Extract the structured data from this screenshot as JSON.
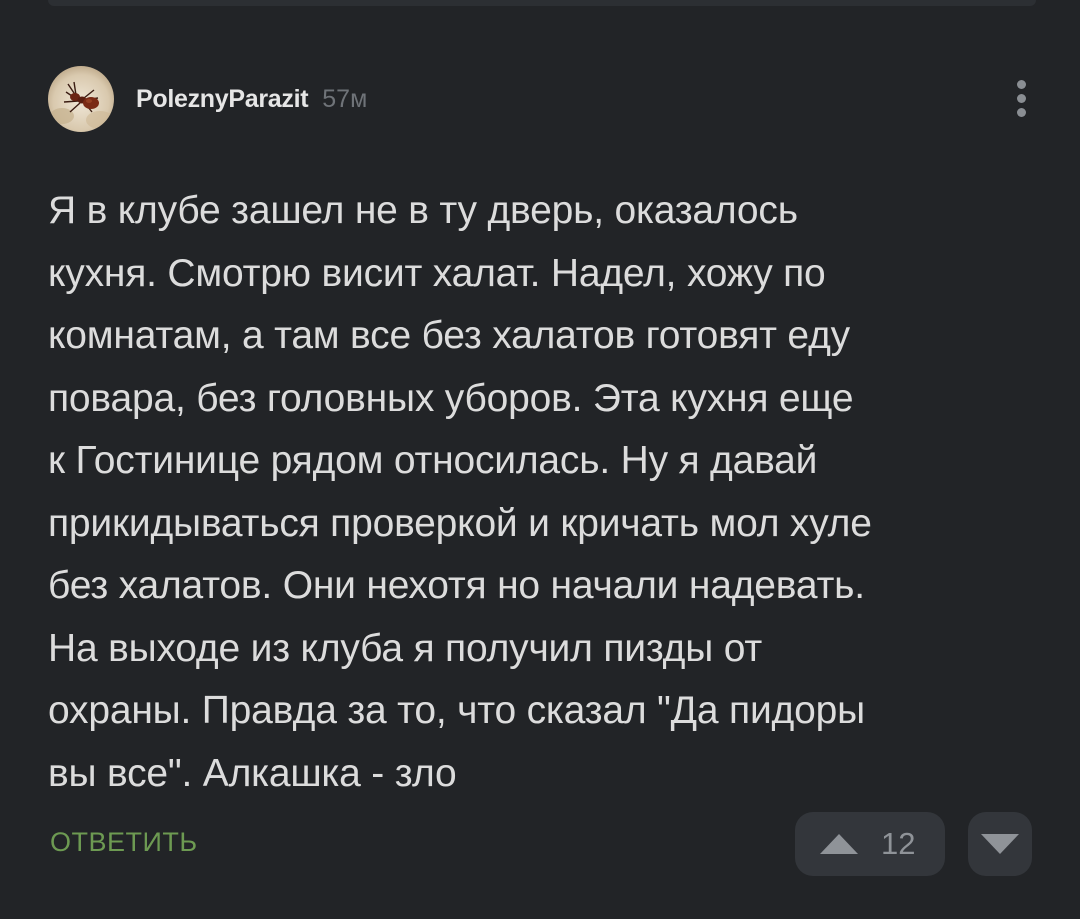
{
  "comment": {
    "author": "PoleznyParazit",
    "time": "57м",
    "text": "Я в клубе зашел не в ту дверь, оказалось\nкухня. Смотрю висит халат. Надел, хожу по\nкомнатам, а там все без халатов готовят еду\nповара, без головных уборов. Эта кухня еще\nк Гостинице рядом относилась. Ну я давай\nприкидываться проверкой и кричать мол хуле\nбез халатов. Они нехотя но начали надевать.\nНа выходе из клуба я получил пизды от\nохраны. Правда за то, что сказал \"Да пидоры\nвы все\". Алкашка - зло",
    "rating": "12"
  },
  "actions": {
    "reply_label": "ОТВЕТИТЬ"
  },
  "icons": {
    "more": "more-vertical-icon",
    "upvote": "triangle-up-icon",
    "downvote": "triangle-down-icon"
  },
  "colors": {
    "background": "#222427",
    "reply_accent": "#6d9a52",
    "vote_button_bg": "#33363b"
  }
}
